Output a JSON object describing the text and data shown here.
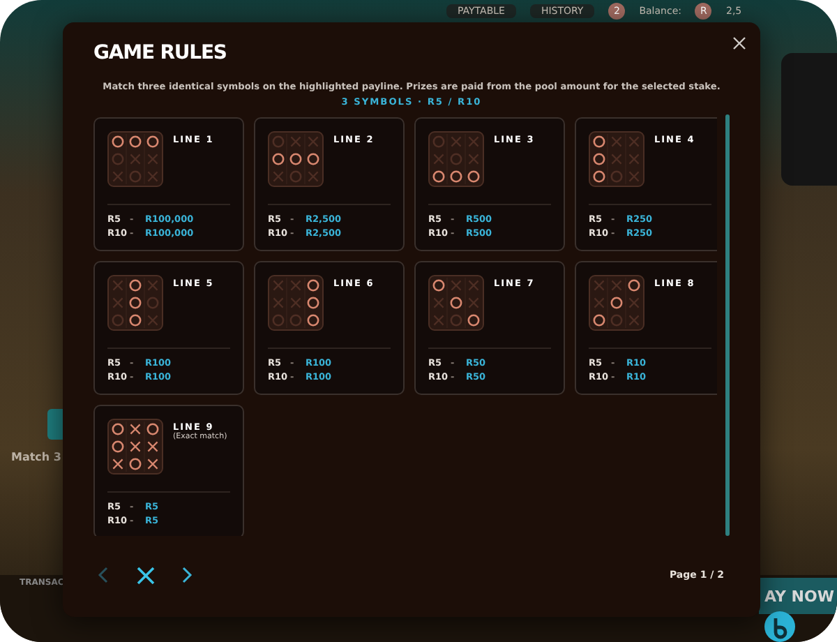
{
  "background": {
    "top_bar": {
      "buttons": [
        "PAYTABLE",
        "HISTORY"
      ],
      "badge": "2",
      "balance_label": "Balance:",
      "currency": "R",
      "balance": "2,5"
    },
    "hint": "Match 3",
    "bottom_bar": {
      "tab": "TRANSAC",
      "play_button": "AY NOW"
    }
  },
  "dialog": {
    "title": "GAME RULES",
    "description": "Match three identical symbols on the highlighted payline. Prizes are paid from the pool amount for the selected stake.",
    "subtitle": "3 SYMBOLS · R5 / R10",
    "lines": [
      {
        "label": "LINE 1",
        "cells": [
          {
            "kind": "circle",
            "lit": true
          },
          {
            "kind": "circle",
            "lit": true
          },
          {
            "kind": "circle",
            "lit": true
          },
          {
            "kind": "circle",
            "lit": false
          },
          {
            "kind": "cross",
            "lit": false
          },
          {
            "kind": "cross",
            "lit": false
          },
          {
            "kind": "cross",
            "lit": false
          },
          {
            "kind": "circle",
            "lit": false
          },
          {
            "kind": "cross",
            "lit": false
          }
        ],
        "prizes": [
          {
            "stake": "R5",
            "dash": "-",
            "amount": "R100,000"
          },
          {
            "stake": "R10",
            "dash": "-",
            "amount": "R100,000"
          }
        ]
      },
      {
        "label": "LINE 2",
        "cells": [
          {
            "kind": "circle",
            "lit": false
          },
          {
            "kind": "cross",
            "lit": false
          },
          {
            "kind": "cross",
            "lit": false
          },
          {
            "kind": "circle",
            "lit": true
          },
          {
            "kind": "circle",
            "lit": true
          },
          {
            "kind": "circle",
            "lit": true
          },
          {
            "kind": "cross",
            "lit": false
          },
          {
            "kind": "circle",
            "lit": false
          },
          {
            "kind": "cross",
            "lit": false
          }
        ],
        "prizes": [
          {
            "stake": "R5",
            "dash": "-",
            "amount": "R2,500"
          },
          {
            "stake": "R10",
            "dash": "-",
            "amount": "R2,500"
          }
        ]
      },
      {
        "label": "LINE 3",
        "cells": [
          {
            "kind": "circle",
            "lit": false
          },
          {
            "kind": "cross",
            "lit": false
          },
          {
            "kind": "cross",
            "lit": false
          },
          {
            "kind": "cross",
            "lit": false
          },
          {
            "kind": "circle",
            "lit": false
          },
          {
            "kind": "cross",
            "lit": false
          },
          {
            "kind": "circle",
            "lit": true
          },
          {
            "kind": "circle",
            "lit": true
          },
          {
            "kind": "circle",
            "lit": true
          }
        ],
        "prizes": [
          {
            "stake": "R5",
            "dash": "-",
            "amount": "R500"
          },
          {
            "stake": "R10",
            "dash": "-",
            "amount": "R500"
          }
        ]
      },
      {
        "label": "LINE 4",
        "cells": [
          {
            "kind": "circle",
            "lit": true
          },
          {
            "kind": "cross",
            "lit": false
          },
          {
            "kind": "cross",
            "lit": false
          },
          {
            "kind": "circle",
            "lit": true
          },
          {
            "kind": "cross",
            "lit": false
          },
          {
            "kind": "cross",
            "lit": false
          },
          {
            "kind": "circle",
            "lit": true
          },
          {
            "kind": "circle",
            "lit": false
          },
          {
            "kind": "cross",
            "lit": false
          }
        ],
        "prizes": [
          {
            "stake": "R5",
            "dash": "-",
            "amount": "R250"
          },
          {
            "stake": "R10",
            "dash": "-",
            "amount": "R250"
          }
        ]
      },
      {
        "label": "LINE 5",
        "cells": [
          {
            "kind": "cross",
            "lit": false
          },
          {
            "kind": "circle",
            "lit": true
          },
          {
            "kind": "cross",
            "lit": false
          },
          {
            "kind": "cross",
            "lit": false
          },
          {
            "kind": "circle",
            "lit": true
          },
          {
            "kind": "circle",
            "lit": false
          },
          {
            "kind": "circle",
            "lit": false
          },
          {
            "kind": "circle",
            "lit": true
          },
          {
            "kind": "cross",
            "lit": false
          }
        ],
        "prizes": [
          {
            "stake": "R5",
            "dash": "-",
            "amount": "R100"
          },
          {
            "stake": "R10",
            "dash": "-",
            "amount": "R100"
          }
        ]
      },
      {
        "label": "LINE 6",
        "cells": [
          {
            "kind": "cross",
            "lit": false
          },
          {
            "kind": "cross",
            "lit": false
          },
          {
            "kind": "circle",
            "lit": true
          },
          {
            "kind": "cross",
            "lit": false
          },
          {
            "kind": "cross",
            "lit": false
          },
          {
            "kind": "circle",
            "lit": true
          },
          {
            "kind": "circle",
            "lit": false
          },
          {
            "kind": "circle",
            "lit": false
          },
          {
            "kind": "circle",
            "lit": true
          }
        ],
        "prizes": [
          {
            "stake": "R5",
            "dash": "-",
            "amount": "R100"
          },
          {
            "stake": "R10",
            "dash": "-",
            "amount": "R100"
          }
        ]
      },
      {
        "label": "LINE 7",
        "cells": [
          {
            "kind": "circle",
            "lit": true
          },
          {
            "kind": "cross",
            "lit": false
          },
          {
            "kind": "cross",
            "lit": false
          },
          {
            "kind": "cross",
            "lit": false
          },
          {
            "kind": "circle",
            "lit": true
          },
          {
            "kind": "cross",
            "lit": false
          },
          {
            "kind": "cross",
            "lit": false
          },
          {
            "kind": "circle",
            "lit": false
          },
          {
            "kind": "circle",
            "lit": true
          }
        ],
        "prizes": [
          {
            "stake": "R5",
            "dash": "-",
            "amount": "R50"
          },
          {
            "stake": "R10",
            "dash": "-",
            "amount": "R50"
          }
        ]
      },
      {
        "label": "LINE 8",
        "cells": [
          {
            "kind": "cross",
            "lit": false
          },
          {
            "kind": "cross",
            "lit": false
          },
          {
            "kind": "circle",
            "lit": true
          },
          {
            "kind": "cross",
            "lit": false
          },
          {
            "kind": "circle",
            "lit": true
          },
          {
            "kind": "cross",
            "lit": false
          },
          {
            "kind": "circle",
            "lit": true
          },
          {
            "kind": "circle",
            "lit": false
          },
          {
            "kind": "cross",
            "lit": false
          }
        ],
        "prizes": [
          {
            "stake": "R5",
            "dash": "-",
            "amount": "R10"
          },
          {
            "stake": "R10",
            "dash": "-",
            "amount": "R10"
          }
        ]
      },
      {
        "label": "LINE 9",
        "note": "(Exact match)",
        "cells": [
          {
            "kind": "circle",
            "lit": true
          },
          {
            "kind": "cross",
            "lit": true
          },
          {
            "kind": "circle",
            "lit": true
          },
          {
            "kind": "circle",
            "lit": true
          },
          {
            "kind": "cross",
            "lit": true
          },
          {
            "kind": "cross",
            "lit": true
          },
          {
            "kind": "cross",
            "lit": true
          },
          {
            "kind": "circle",
            "lit": true
          },
          {
            "kind": "cross",
            "lit": true
          }
        ],
        "prizes": [
          {
            "stake": "R5",
            "dash": "-",
            "amount": "R5"
          },
          {
            "stake": "R10",
            "dash": "-",
            "amount": "R5"
          }
        ]
      }
    ],
    "pager": {
      "prev_disabled": true,
      "next_disabled": false,
      "page": "Page 1 / 2"
    }
  }
}
